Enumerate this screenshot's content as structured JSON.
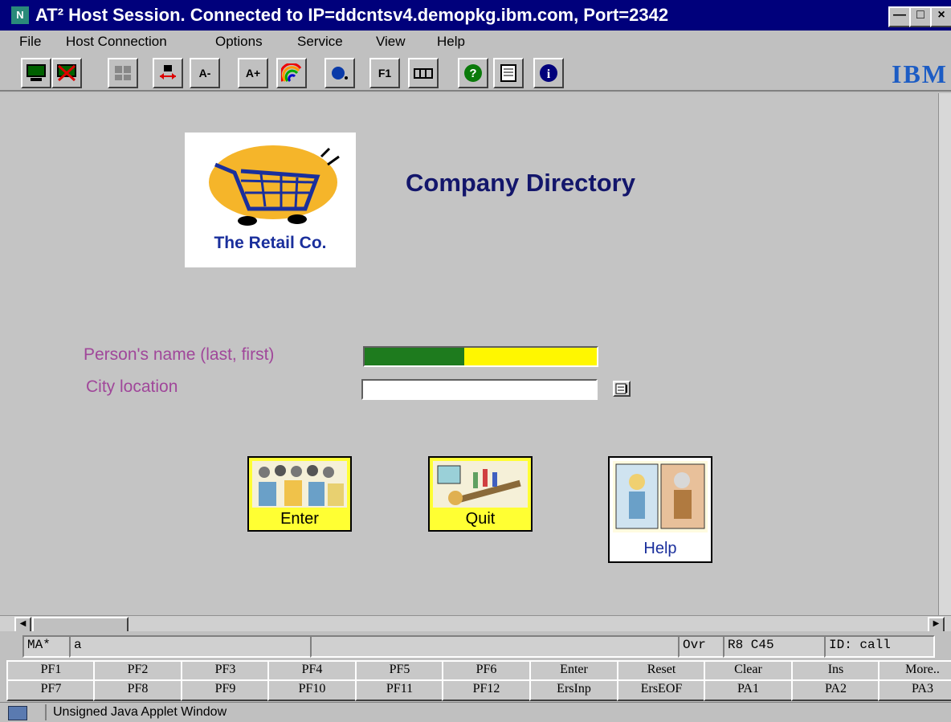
{
  "window": {
    "title": "AT² Host Session. Connected to IP=ddcntsv4.demopkg.ibm.com, Port=2342",
    "icon_label": "N",
    "minimize_glyph": "—",
    "maximize_glyph": "□",
    "close_glyph": "×"
  },
  "menu": [
    "File",
    "Host Connection",
    "Options",
    "Service",
    "View",
    "Help"
  ],
  "toolbar": {
    "font_small": "A-",
    "font_large": "A+",
    "function_key": "F1",
    "help_glyph": "?",
    "info_glyph": "i",
    "brand": "IBM"
  },
  "screen": {
    "logo_text": "The Retail Co.",
    "title": "Company Directory",
    "name_label": "Person's name (last, first)",
    "city_label": "City location",
    "city_value": "",
    "name_fill": 0.43,
    "buttons": {
      "enter": "Enter",
      "quit": "Quit",
      "help": "Help"
    }
  },
  "status": {
    "mode": "MA*",
    "input": "a",
    "overwrite": "Ovr",
    "cursor": "R8  C45",
    "id": "ID: call"
  },
  "pfkeys": {
    "row1": [
      "PF1",
      "PF2",
      "PF3",
      "PF4",
      "PF5",
      "PF6",
      "Enter",
      "Reset",
      "Clear",
      "Ins",
      "More.."
    ],
    "row2": [
      "PF7",
      "PF8",
      "PF9",
      "PF10",
      "PF11",
      "PF12",
      "ErsInp",
      "ErsEOF",
      "PA1",
      "PA2",
      "PA3"
    ]
  },
  "applet_bar": "Unsigned Java Applet Window",
  "colors": {
    "title_bar": "#00007b",
    "heading": "#13166b",
    "field_label": "#a0479a",
    "field_filled": "#1e7b1e",
    "field_empty": "#fff700",
    "button_yellow": "#ffff33"
  }
}
